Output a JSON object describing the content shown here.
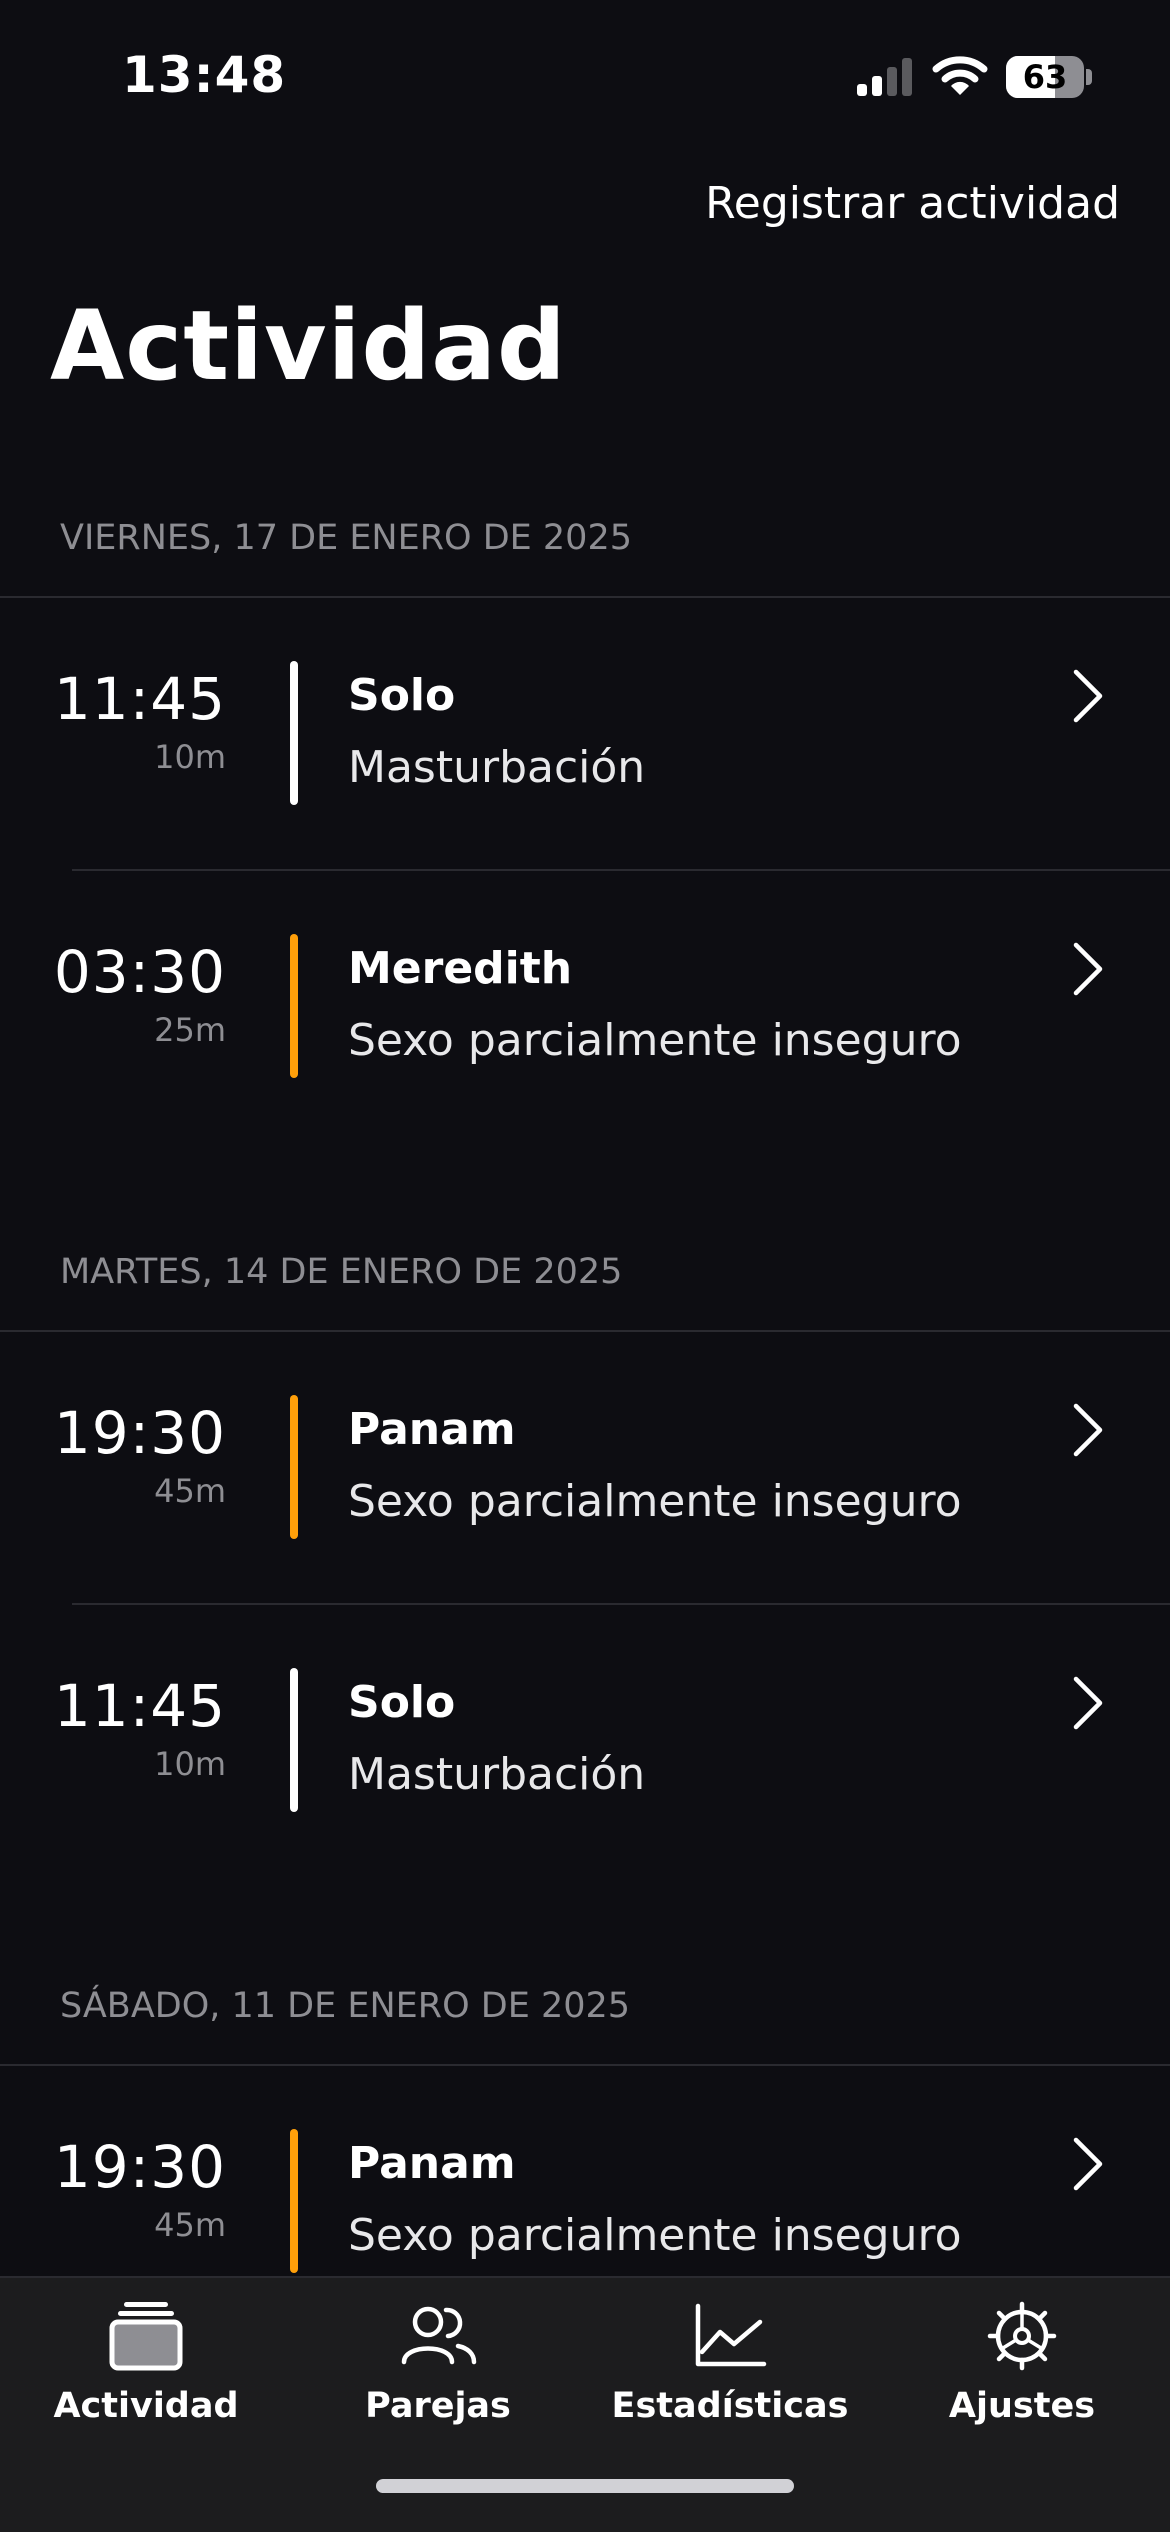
{
  "status_bar": {
    "time": "13:48",
    "battery": "63",
    "battery_level": 0.63
  },
  "header": {
    "register_label": "Registrar actividad",
    "title": "Actividad"
  },
  "sections": [
    {
      "date": "VIERNES, 17 DE ENERO DE 2025",
      "entries": [
        {
          "time": "11:45",
          "duration": "10m",
          "name": "Solo",
          "type": "Masturbación",
          "accent": "#ffffff"
        },
        {
          "time": "03:30",
          "duration": "25m",
          "name": "Meredith",
          "type": "Sexo parcialmente inseguro",
          "accent": "#ff9f0a"
        }
      ]
    },
    {
      "date": "MARTES, 14 DE ENERO DE 2025",
      "entries": [
        {
          "time": "19:30",
          "duration": "45m",
          "name": "Panam",
          "type": "Sexo parcialmente inseguro",
          "accent": "#ff9f0a"
        },
        {
          "time": "11:45",
          "duration": "10m",
          "name": "Solo",
          "type": "Masturbación",
          "accent": "#ffffff"
        }
      ]
    },
    {
      "date": "SÁBADO, 11 DE ENERO DE 2025",
      "entries": [
        {
          "time": "19:30",
          "duration": "45m",
          "name": "Panam",
          "type": "Sexo parcialmente inseguro",
          "accent": "#ff9f0a"
        }
      ]
    }
  ],
  "tab_bar": {
    "tabs": [
      {
        "label": "Actividad",
        "icon": "stack-icon"
      },
      {
        "label": "Parejas",
        "icon": "people-icon"
      },
      {
        "label": "Estadísticas",
        "icon": "chart-icon"
      },
      {
        "label": "Ajustes",
        "icon": "gear-icon"
      }
    ]
  }
}
